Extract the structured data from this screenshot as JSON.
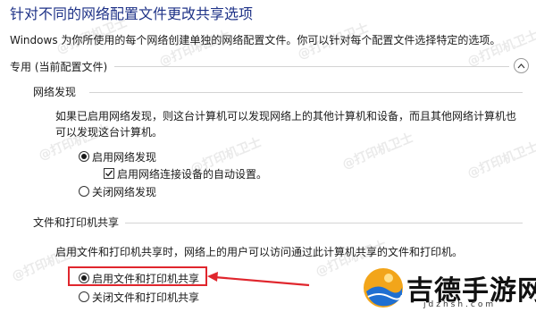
{
  "title": "针对不同的网络配置文件更改共享选项",
  "description": "Windows 为你所使用的每个网络创建单独的网络配置文件。你可以针对每个配置文件选择特定的选项。",
  "profile_section": {
    "label": "专用 (当前配置文件)",
    "collapse_icon": "chevron-up-icon"
  },
  "network_discovery": {
    "header": "网络发现",
    "description_line1": "如果已启用网络发现，则这台计算机可以发现网络上的其他计算机和设备，而且其他网络计算机也",
    "description_line2": "可以发现这台计算机。",
    "option_on": "启用网络发现",
    "auto_setup": "启用网络连接设备的自动设置。",
    "option_off": "关闭网络发现",
    "selected": "on",
    "auto_setup_checked": true
  },
  "file_printer_sharing": {
    "header": "文件和打印机共享",
    "description": "启用文件和打印机共享时，网络上的用户可以访问通过此计算机共享的文件和打印机。",
    "option_on": "启用文件和打印机共享",
    "option_off": "关闭文件和打印机共享",
    "selected": "on"
  },
  "annotation": {
    "highlight_color": "#e0262d"
  },
  "watermark": {
    "text": "@打印机卫士"
  },
  "logo": {
    "name": "吉德手游网",
    "url_text": "jdzhsh.com"
  }
}
